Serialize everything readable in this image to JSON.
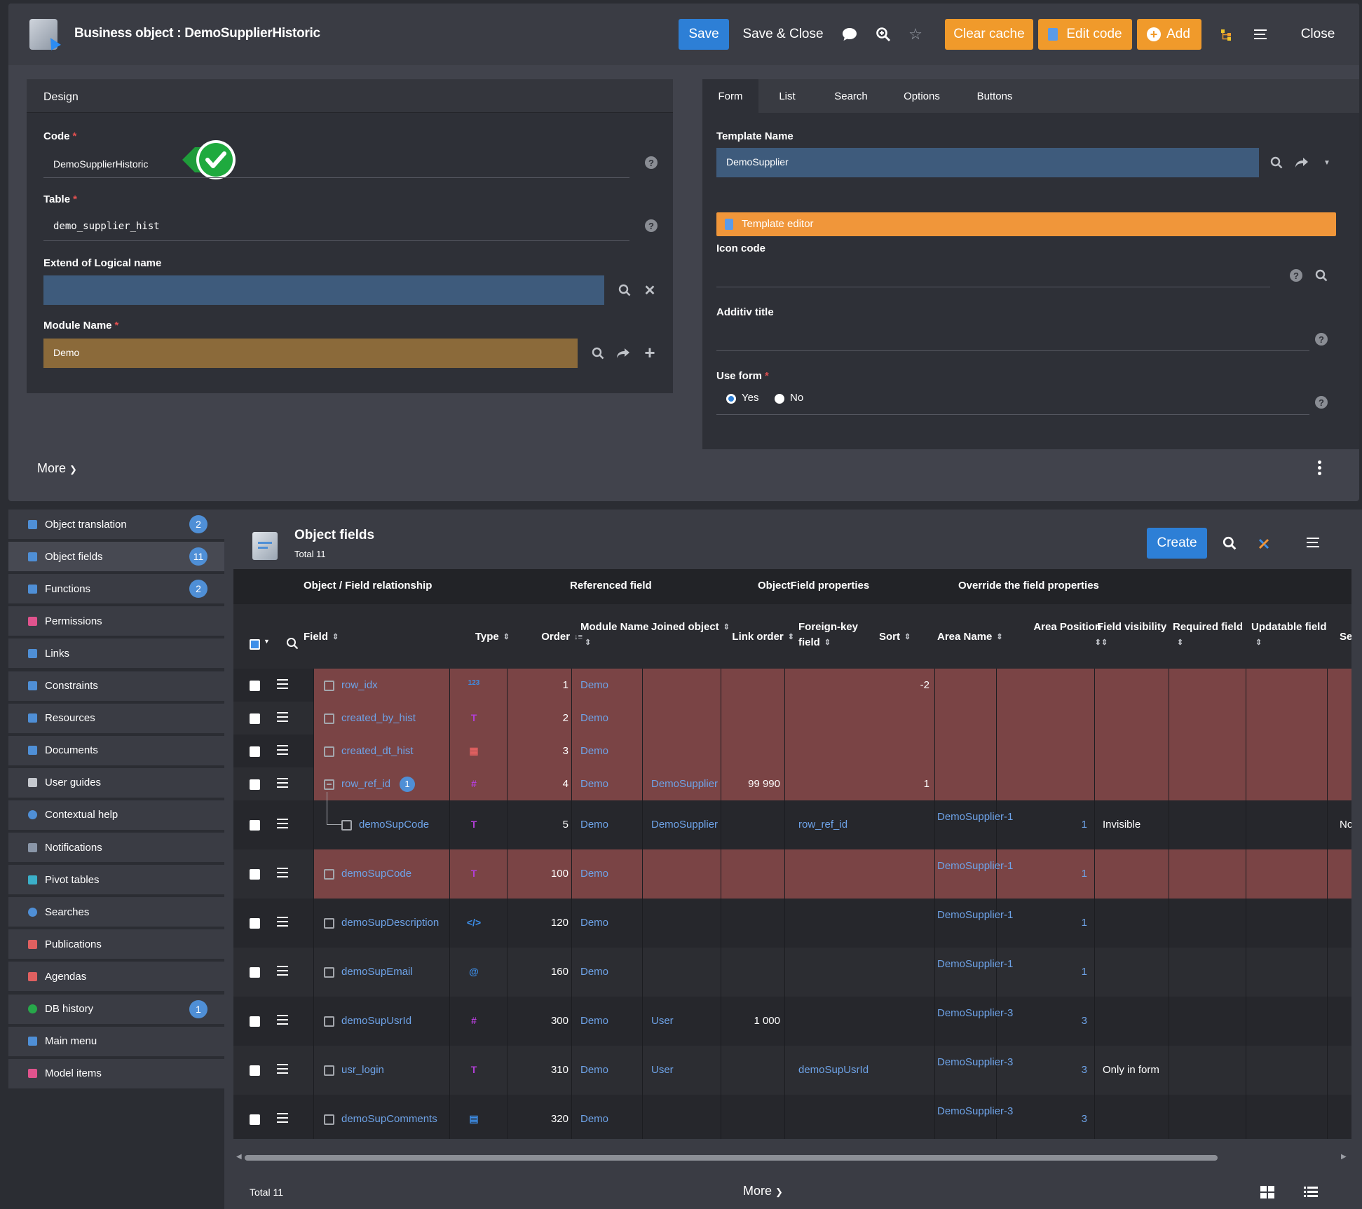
{
  "window": {
    "title": "Business object : DemoSupplierHistoric",
    "buttons": {
      "save": "Save",
      "save_close": "Save & Close",
      "clear_cache": "Clear cache",
      "edit_code": "Edit code",
      "add": "Add",
      "close": "Close"
    }
  },
  "design": {
    "header": "Design",
    "code_label": "Code",
    "code_value": "DemoSupplierHistoric",
    "table_label": "Table",
    "table_value": "demo_supplier_hist",
    "extend_label": "Extend of Logical name",
    "extend_value": "",
    "module_label": "Module Name",
    "module_value": "Demo",
    "more": "More"
  },
  "form_panel": {
    "tabs": [
      "Form",
      "List",
      "Search",
      "Options",
      "Buttons"
    ],
    "active_tab": "Form",
    "template_label": "Template Name",
    "template_value": "DemoSupplier",
    "template_editor": "Template editor",
    "icon_label": "Icon code",
    "icon_value": "",
    "additiv_label": "Additiv title",
    "additiv_value": "",
    "use_form_label": "Use form",
    "yes": "Yes",
    "no": "No",
    "selected": "Yes"
  },
  "sidebar": {
    "items": [
      {
        "label": "Object translation",
        "badge": "2",
        "icon": "translation-icon"
      },
      {
        "label": "Object fields",
        "badge": "11",
        "icon": "fields-icon"
      },
      {
        "label": "Functions",
        "badge": "2",
        "icon": "function-icon"
      },
      {
        "label": "Permissions",
        "badge": "",
        "icon": "permission-icon"
      },
      {
        "label": "Links",
        "badge": "",
        "icon": "link-icon"
      },
      {
        "label": "Constraints",
        "badge": "",
        "icon": "constraint-icon"
      },
      {
        "label": "Resources",
        "badge": "",
        "icon": "resource-icon"
      },
      {
        "label": "Documents",
        "badge": "",
        "icon": "document-icon"
      },
      {
        "label": "User guides",
        "badge": "",
        "icon": "guide-icon"
      },
      {
        "label": "Contextual help",
        "badge": "",
        "icon": "help-icon"
      },
      {
        "label": "Notifications",
        "badge": "",
        "icon": "gear-icon"
      },
      {
        "label": "Pivot tables",
        "badge": "",
        "icon": "pivot-icon"
      },
      {
        "label": "Searches",
        "badge": "",
        "icon": "search-icon"
      },
      {
        "label": "Publications",
        "badge": "",
        "icon": "publication-icon"
      },
      {
        "label": "Agendas",
        "badge": "",
        "icon": "calendar-icon"
      },
      {
        "label": "DB history",
        "badge": "1",
        "icon": "history-icon"
      },
      {
        "label": "Main menu",
        "badge": "",
        "icon": "menu-icon"
      },
      {
        "label": "Model items",
        "badge": "",
        "icon": "share-icon"
      }
    ]
  },
  "list": {
    "title": "Object fields",
    "total": "Total 11",
    "create": "Create",
    "groups": [
      "Object / Field relationship",
      "Referenced field",
      "ObjectField properties",
      "Override the field properties"
    ],
    "columns": [
      "Field",
      "Type",
      "Order",
      "Module Name",
      "Joined object",
      "Link order",
      "Foreign-key field",
      "Sort",
      "Area Name",
      "Area Position",
      "Field visibility",
      "Required field",
      "Updatable field",
      "Se"
    ],
    "rows": [
      {
        "field": "row_idx",
        "type": "123",
        "order": "1",
        "module": "Demo",
        "joined": "",
        "link": "",
        "fk": "",
        "sort": "-2",
        "area": "",
        "apos": "",
        "vis": "",
        "se": "",
        "hl": true
      },
      {
        "field": "created_by_hist",
        "type": "T",
        "order": "2",
        "module": "Demo",
        "joined": "",
        "link": "",
        "fk": "",
        "sort": "",
        "area": "",
        "apos": "",
        "vis": "",
        "se": "",
        "hl": true
      },
      {
        "field": "created_dt_hist",
        "type": "cal",
        "order": "3",
        "module": "Demo",
        "joined": "",
        "link": "",
        "fk": "",
        "sort": "",
        "area": "",
        "apos": "",
        "vis": "",
        "se": "",
        "hl": true
      },
      {
        "field": "row_ref_id",
        "type": "#",
        "order": "4",
        "module": "Demo",
        "joined": "DemoSupplier",
        "link": "99 990",
        "fk": "",
        "sort": "1",
        "area": "",
        "apos": "",
        "vis": "",
        "se": "",
        "hl": true,
        "count": "1"
      },
      {
        "field": "demoSupCode",
        "type": "Tg",
        "order": "5",
        "module": "Demo",
        "joined": "DemoSupplier",
        "link": "",
        "fk": "row_ref_id",
        "sort": "",
        "area": "DemoSupplier-1",
        "apos": "1",
        "vis": "Invisible",
        "se": "Nc",
        "hl": false,
        "child": true
      },
      {
        "field": "demoSupCode",
        "type": "Tg",
        "order": "100",
        "module": "Demo",
        "joined": "",
        "link": "",
        "fk": "",
        "sort": "",
        "area": "DemoSupplier-1",
        "apos": "1",
        "vis": "",
        "se": "",
        "hl": true
      },
      {
        "field": "demoSupDescription",
        "type": "</>",
        "order": "120",
        "module": "Demo",
        "joined": "",
        "link": "",
        "fk": "",
        "sort": "",
        "area": "DemoSupplier-1",
        "apos": "1",
        "vis": "",
        "se": "",
        "hl": false
      },
      {
        "field": "demoSupEmail",
        "type": "@",
        "order": "160",
        "module": "Demo",
        "joined": "",
        "link": "",
        "fk": "",
        "sort": "",
        "area": "DemoSupplier-1",
        "apos": "1",
        "vis": "",
        "se": "",
        "hl": false
      },
      {
        "field": "demoSupUsrId",
        "type": "#",
        "order": "300",
        "module": "Demo",
        "joined": "User",
        "link": "1 000",
        "fk": "",
        "sort": "",
        "area": "DemoSupplier-3",
        "apos": "3",
        "vis": "",
        "se": "",
        "hl": false
      },
      {
        "field": "usr_login",
        "type": "Tg",
        "order": "310",
        "module": "Demo",
        "joined": "User",
        "link": "",
        "fk": "demoSupUsrId",
        "sort": "",
        "area": "DemoSupplier-3",
        "apos": "3",
        "vis": "Only in form",
        "se": "",
        "hl": false
      },
      {
        "field": "demoSupComments",
        "type": "doc",
        "order": "320",
        "module": "Demo",
        "joined": "",
        "link": "",
        "fk": "",
        "sort": "",
        "area": "DemoSupplier-3",
        "apos": "3",
        "vis": "",
        "se": "",
        "hl": false
      }
    ],
    "footer_total": "Total 11",
    "footer_more": "More"
  },
  "colors": {
    "highlight": "#7a4445",
    "link": "#6ea3e8",
    "accent": "#2d7fd6",
    "orange": "#f09a2b"
  }
}
